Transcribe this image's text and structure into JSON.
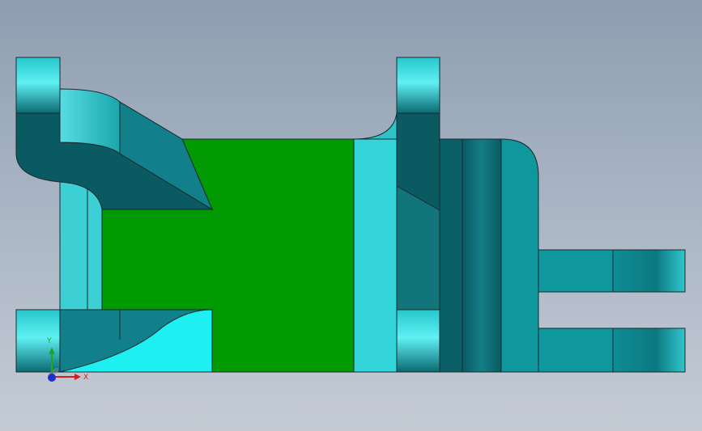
{
  "viewport": {
    "background_top": "#8e9db0",
    "background_bottom": "#c4cbd5"
  },
  "colors": {
    "green_face": "#029a02",
    "cyan_bright": "#33dfe3",
    "cyan_light": "#5ad9de",
    "teal_mid": "#138b93",
    "teal_dark": "#0a5b62",
    "teal_face": "#0e9aa0",
    "outline": "#1a2a2e"
  },
  "triad": {
    "x_label": "X",
    "y_label": "Y",
    "x_color": "#d21e1e",
    "y_color": "#1ea81e",
    "z_color": "#1c2fd0"
  }
}
